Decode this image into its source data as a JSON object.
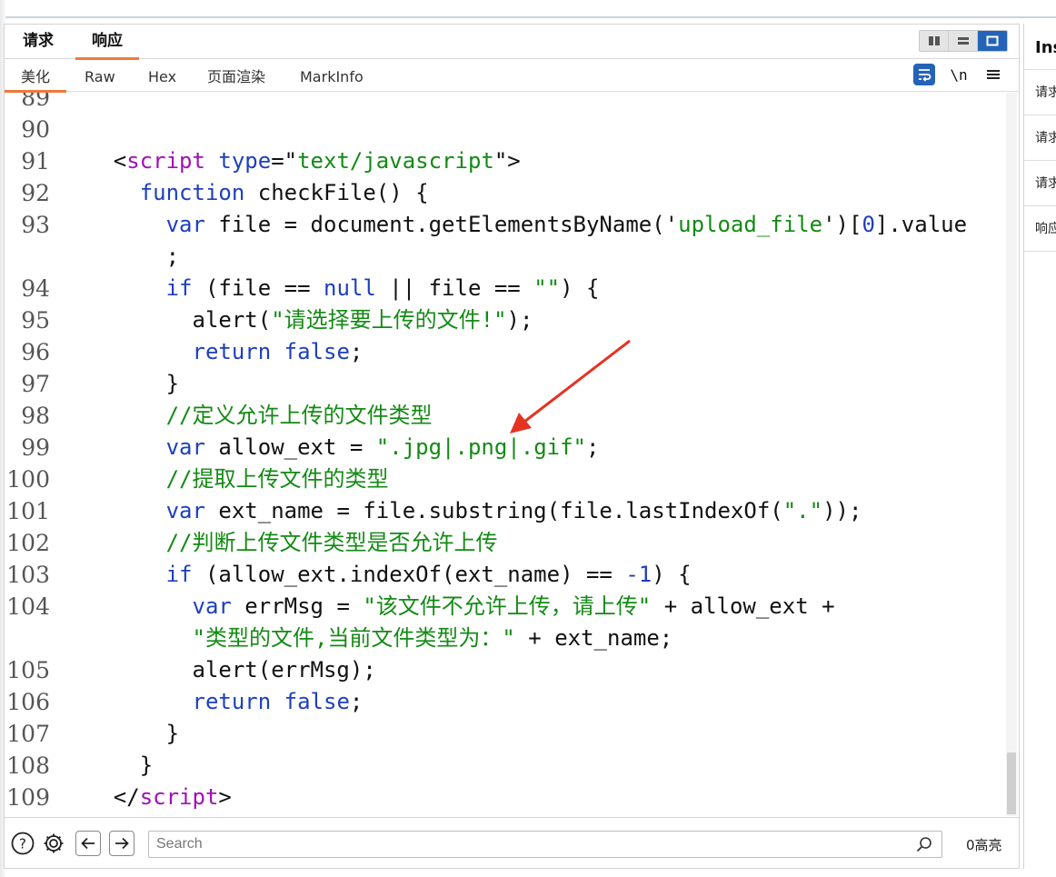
{
  "tabs": {
    "primary": [
      "请求",
      "响应"
    ],
    "secondary": [
      "美化",
      "Raw",
      "Hex",
      "页面渲染",
      "MarkInfo"
    ],
    "newline_label": "\\n"
  },
  "icons": {
    "view_split": "split-columns-icon",
    "view_rows": "split-rows-icon",
    "view_single": "single-pane-icon",
    "wrap": "word-wrap-icon",
    "menu": "hamburger-menu-icon",
    "help": "help-icon",
    "settings": "gear-icon",
    "back": "arrow-left-icon",
    "forward": "arrow-right-icon",
    "search": "search-icon"
  },
  "code": {
    "line_numbers": [
      "89",
      "90",
      "91",
      "92",
      "93",
      "",
      "94",
      "95",
      "96",
      "97",
      "98",
      "99",
      "100",
      "101",
      "102",
      "103",
      "104",
      "",
      "105",
      "106",
      "107",
      "108",
      "109"
    ],
    "lines": [
      [],
      [],
      [
        {
          "t": "    <",
          "c": "punc"
        },
        {
          "t": "script",
          "c": "tag"
        },
        {
          "t": " ",
          "c": "plain"
        },
        {
          "t": "type",
          "c": "attr"
        },
        {
          "t": "=\"",
          "c": "punc"
        },
        {
          "t": "text/javascript",
          "c": "str"
        },
        {
          "t": "\">",
          "c": "punc"
        }
      ],
      [
        {
          "t": "      ",
          "c": "plain"
        },
        {
          "t": "function",
          "c": "kw"
        },
        {
          "t": " checkFile() {",
          "c": "plain"
        }
      ],
      [
        {
          "t": "        ",
          "c": "plain"
        },
        {
          "t": "var",
          "c": "kw"
        },
        {
          "t": " file = document.getElementsByName('",
          "c": "plain"
        },
        {
          "t": "upload_file",
          "c": "str"
        },
        {
          "t": "')[",
          "c": "plain"
        },
        {
          "t": "0",
          "c": "num"
        },
        {
          "t": "].value",
          "c": "plain"
        }
      ],
      [
        {
          "t": "        ;",
          "c": "plain"
        }
      ],
      [
        {
          "t": "        ",
          "c": "plain"
        },
        {
          "t": "if",
          "c": "kw"
        },
        {
          "t": " (file == ",
          "c": "plain"
        },
        {
          "t": "null",
          "c": "kw"
        },
        {
          "t": " || file == ",
          "c": "plain"
        },
        {
          "t": "\"\"",
          "c": "str"
        },
        {
          "t": ") {",
          "c": "plain"
        }
      ],
      [
        {
          "t": "          alert(",
          "c": "plain"
        },
        {
          "t": "\"请选择要上传的文件!\"",
          "c": "str"
        },
        {
          "t": ");",
          "c": "plain"
        }
      ],
      [
        {
          "t": "          ",
          "c": "plain"
        },
        {
          "t": "return false",
          "c": "kw"
        },
        {
          "t": ";",
          "c": "plain"
        }
      ],
      [
        {
          "t": "        }",
          "c": "plain"
        }
      ],
      [
        {
          "t": "        ",
          "c": "plain"
        },
        {
          "t": "//定义允许上传的文件类型",
          "c": "com"
        }
      ],
      [
        {
          "t": "        ",
          "c": "plain"
        },
        {
          "t": "var",
          "c": "kw"
        },
        {
          "t": " allow_ext = ",
          "c": "plain"
        },
        {
          "t": "\".jpg|.png|.gif\"",
          "c": "str"
        },
        {
          "t": ";",
          "c": "plain"
        }
      ],
      [
        {
          "t": "        ",
          "c": "plain"
        },
        {
          "t": "//提取上传文件的类型",
          "c": "com"
        }
      ],
      [
        {
          "t": "        ",
          "c": "plain"
        },
        {
          "t": "var",
          "c": "kw"
        },
        {
          "t": " ext_name = file.substring(file.lastIndexOf(",
          "c": "plain"
        },
        {
          "t": "\".\"",
          "c": "str"
        },
        {
          "t": "));",
          "c": "plain"
        }
      ],
      [
        {
          "t": "        ",
          "c": "plain"
        },
        {
          "t": "//判断上传文件类型是否允许上传",
          "c": "com"
        }
      ],
      [
        {
          "t": "        ",
          "c": "plain"
        },
        {
          "t": "if",
          "c": "kw"
        },
        {
          "t": " (allow_ext.indexOf(ext_name) == ",
          "c": "plain"
        },
        {
          "t": "-1",
          "c": "num"
        },
        {
          "t": ") {",
          "c": "plain"
        }
      ],
      [
        {
          "t": "          ",
          "c": "plain"
        },
        {
          "t": "var",
          "c": "kw"
        },
        {
          "t": " errMsg = ",
          "c": "plain"
        },
        {
          "t": "\"该文件不允许上传，请上传\"",
          "c": "str"
        },
        {
          "t": " + allow_ext +",
          "c": "plain"
        }
      ],
      [
        {
          "t": "          ",
          "c": "plain"
        },
        {
          "t": "\"类型的文件,当前文件类型为：\"",
          "c": "str"
        },
        {
          "t": " + ext_name;",
          "c": "plain"
        }
      ],
      [
        {
          "t": "          alert(errMsg);",
          "c": "plain"
        }
      ],
      [
        {
          "t": "          ",
          "c": "plain"
        },
        {
          "t": "return false",
          "c": "kw"
        },
        {
          "t": ";",
          "c": "plain"
        }
      ],
      [
        {
          "t": "        }",
          "c": "plain"
        }
      ],
      [
        {
          "t": "      }",
          "c": "plain"
        }
      ],
      [
        {
          "t": "    </",
          "c": "punc"
        },
        {
          "t": "script",
          "c": "tag"
        },
        {
          "t": ">",
          "c": "punc"
        }
      ]
    ]
  },
  "search": {
    "placeholder": "Search",
    "highlight_count": "0高亮"
  },
  "inspector": {
    "title": "Inspector",
    "items": [
      "请求属性",
      "请求头",
      "请求Cookie",
      "响应头"
    ]
  },
  "colors": {
    "accent_tab": "#f07a3a",
    "active_blue": "#2563b8",
    "keyword": "#1d3fbd",
    "tag": "#a010b8",
    "string": "#148a14",
    "annotation_arrow": "#e63222"
  }
}
